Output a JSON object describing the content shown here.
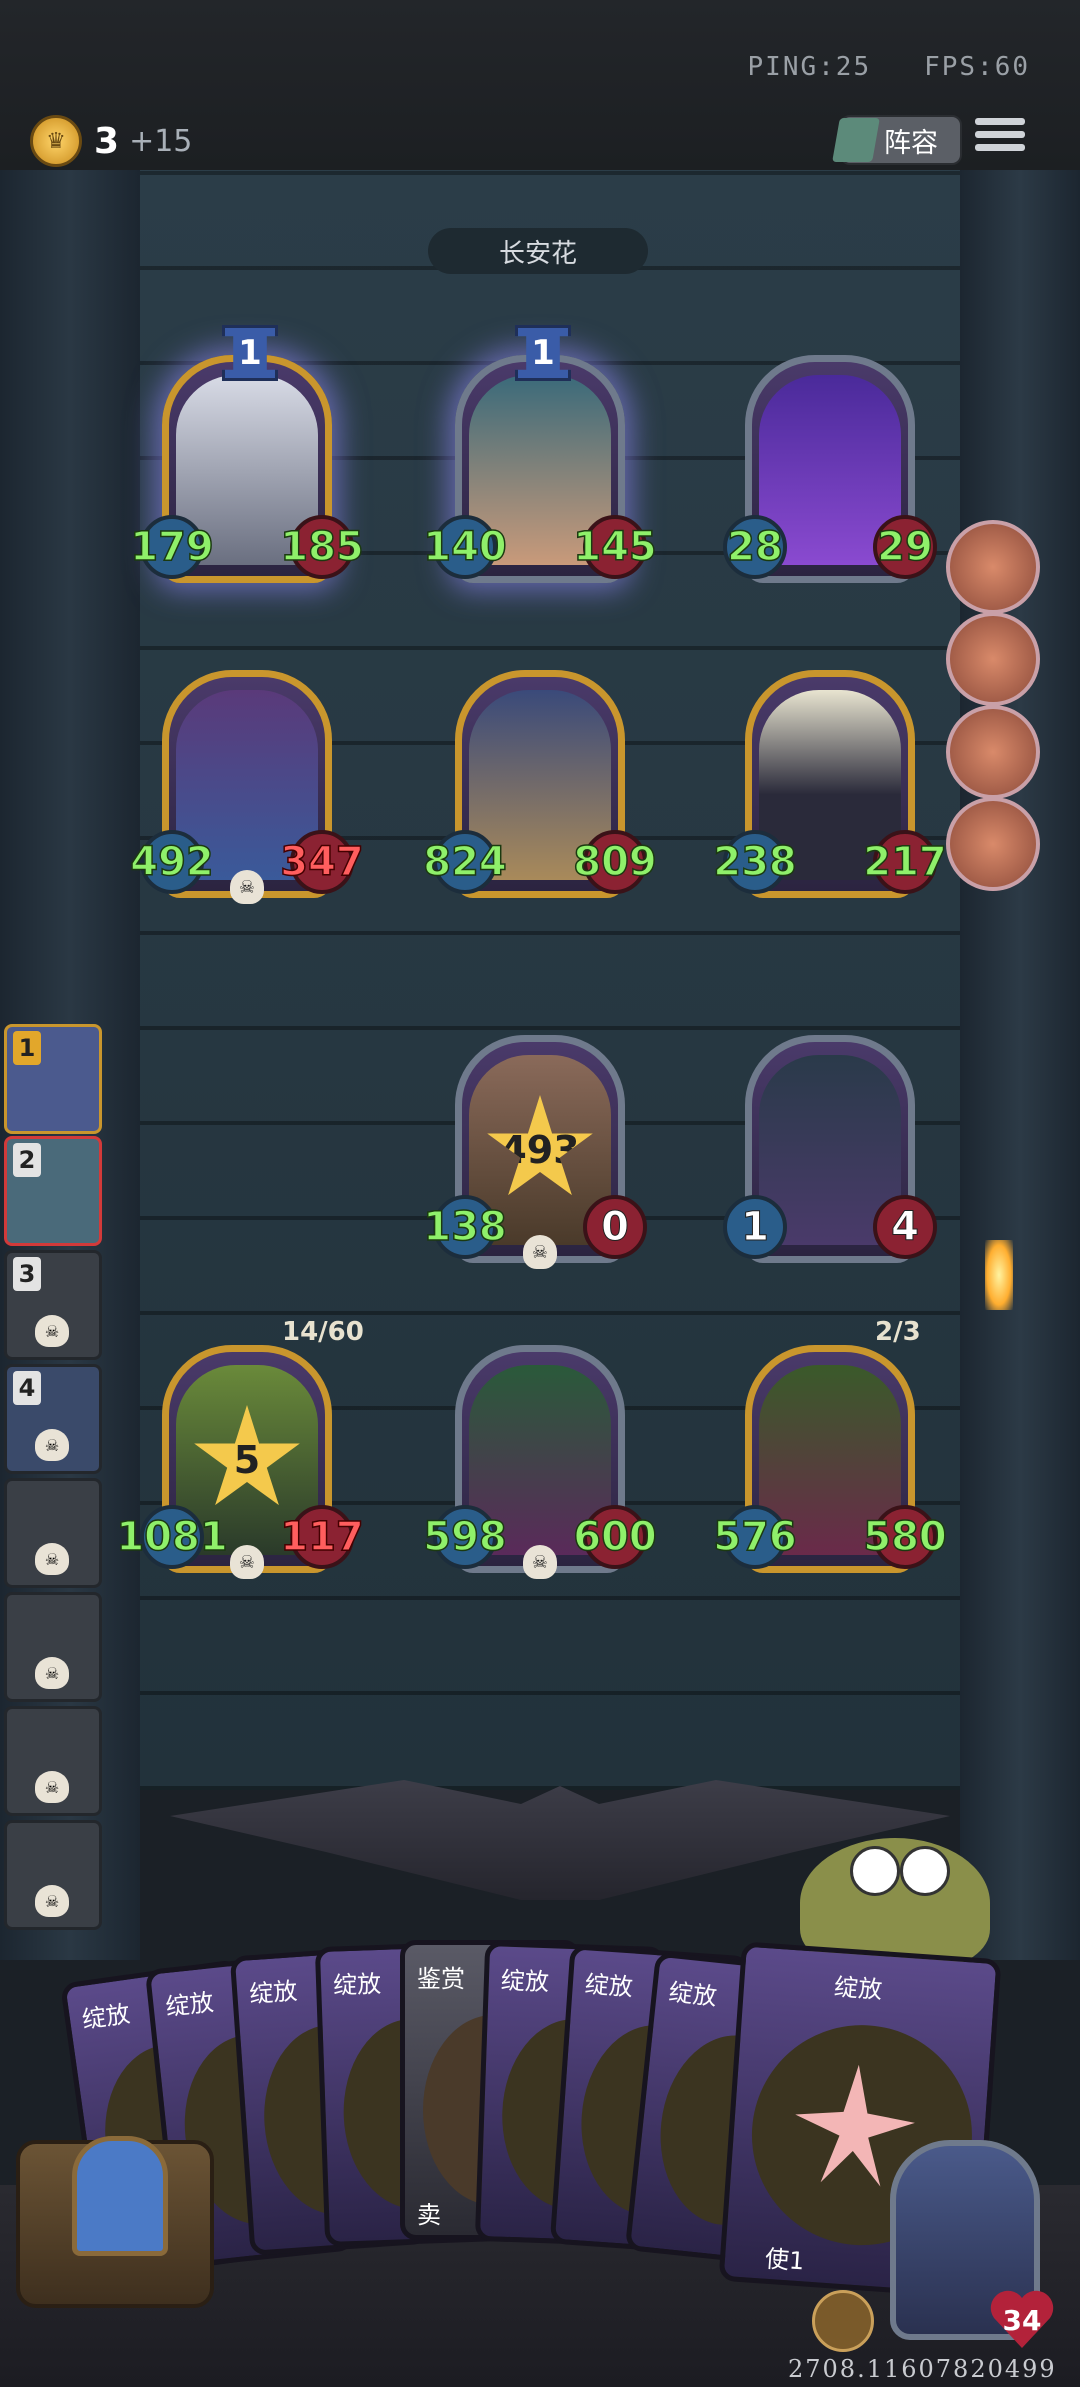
{
  "top_bar": {
    "ping_label": "PING:25",
    "fps_label": "FPS:60",
    "gold": "3",
    "gold_income": "+15",
    "lineup_label": "阵容"
  },
  "opponent_name": "长安花",
  "board": {
    "row1": [
      {
        "attack": "179",
        "health": "185",
        "tier": "1"
      },
      {
        "attack": "140",
        "health": "145",
        "tier": "1"
      },
      {
        "attack": "28",
        "health": "29"
      }
    ],
    "row2": [
      {
        "attack": "492",
        "health": "347"
      },
      {
        "attack": "824",
        "health": "809"
      },
      {
        "attack": "238",
        "health": "217"
      }
    ],
    "row3": [
      {
        "attack": "138",
        "health": "0",
        "burst": "493"
      },
      {
        "attack": "1",
        "health": "4"
      }
    ],
    "row4": [
      {
        "attack": "1081",
        "health": "117",
        "counter": "14/60",
        "burst": "5"
      },
      {
        "attack": "598",
        "health": "600"
      },
      {
        "attack": "576",
        "health": "580",
        "counter": "2/3"
      }
    ]
  },
  "side_list": [
    "1",
    "2",
    "3",
    "4"
  ],
  "hand_cards": [
    "绽放",
    "绽放",
    "绽放",
    "绽放",
    "鉴赏",
    "绽放",
    "绽放",
    "绽放",
    "绽放"
  ],
  "hand_card_text": {
    "sell_partial": "卖",
    "use_partial": "使1"
  },
  "hero_health": "34",
  "game_id": "2708.11607820499"
}
